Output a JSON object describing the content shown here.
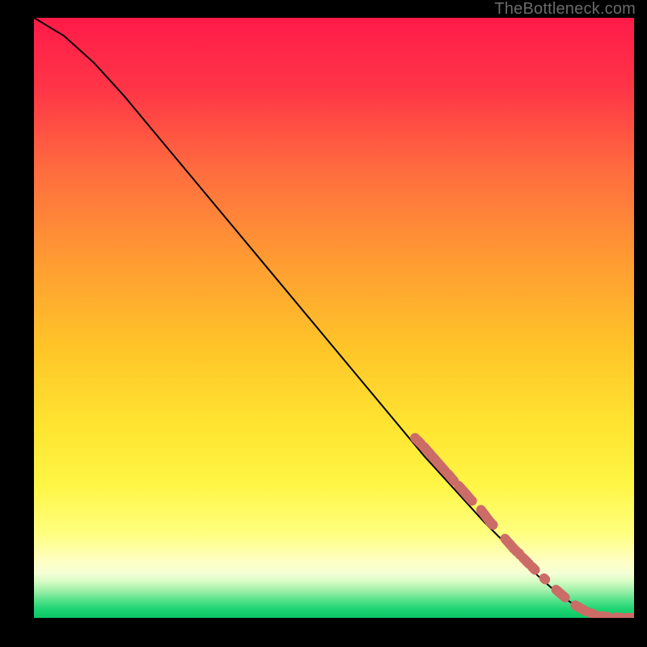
{
  "watermark": "TheBottleneck.com",
  "chart_data": {
    "type": "line",
    "title": "",
    "xlabel": "",
    "ylabel": "",
    "xlim": [
      0,
      100
    ],
    "ylim": [
      0,
      100
    ],
    "curve": {
      "name": "bottleneck-curve",
      "x": [
        0,
        5,
        10,
        15,
        20,
        25,
        30,
        35,
        40,
        45,
        50,
        55,
        60,
        65,
        70,
        75,
        80,
        82,
        84,
        86,
        88,
        90,
        92,
        94,
        96,
        98,
        100
      ],
      "y": [
        100,
        97,
        92.5,
        87,
        81,
        75,
        69,
        63,
        57,
        51,
        45,
        39,
        33,
        27,
        21.5,
        16,
        11,
        9,
        7,
        5.2,
        3.6,
        2.2,
        1.2,
        0.5,
        0.15,
        0.03,
        0
      ]
    },
    "markers": {
      "name": "segments",
      "color": "#cc6c67",
      "points": [
        [
          63.5,
          30.0
        ],
        [
          64.5,
          29.0
        ],
        [
          65.0,
          28.5
        ],
        [
          68.5,
          24.5
        ],
        [
          69.0,
          24.0
        ],
        [
          70.0,
          22.8
        ],
        [
          70.8,
          22.0
        ],
        [
          73.0,
          19.5
        ],
        [
          74.5,
          18.0
        ],
        [
          76.0,
          16.0
        ],
        [
          76.0,
          16.0
        ],
        [
          76.5,
          15.5
        ],
        [
          78.5,
          13.2
        ],
        [
          80.0,
          11.5
        ],
        [
          80.0,
          11.5
        ],
        [
          80.5,
          11.0
        ],
        [
          80.8,
          10.8
        ],
        [
          81.0,
          10.5
        ],
        [
          81.5,
          10.0
        ],
        [
          82.5,
          9.0
        ],
        [
          83.0,
          8.5
        ],
        [
          83.5,
          8.0
        ],
        [
          85.0,
          6.6
        ],
        [
          85.2,
          6.4
        ],
        [
          87.0,
          4.7
        ],
        [
          88.5,
          3.4
        ],
        [
          90.2,
          2.1
        ],
        [
          92.0,
          1.1
        ],
        [
          92.8,
          0.8
        ],
        [
          93.5,
          0.5
        ],
        [
          94.5,
          0.3
        ],
        [
          95.8,
          0.15
        ],
        [
          97.0,
          0.08
        ],
        [
          98.0,
          0.04
        ],
        [
          98.8,
          0.02
        ],
        [
          99.8,
          0.0
        ]
      ]
    },
    "gradient_stops": [
      {
        "offset": 0.0,
        "color": "#ff1a49"
      },
      {
        "offset": 0.12,
        "color": "#ff3647"
      },
      {
        "offset": 0.25,
        "color": "#ff6b3f"
      },
      {
        "offset": 0.4,
        "color": "#ff9a33"
      },
      {
        "offset": 0.55,
        "color": "#ffc528"
      },
      {
        "offset": 0.68,
        "color": "#ffe431"
      },
      {
        "offset": 0.78,
        "color": "#fff645"
      },
      {
        "offset": 0.86,
        "color": "#ffff80"
      },
      {
        "offset": 0.905,
        "color": "#ffffc3"
      },
      {
        "offset": 0.926,
        "color": "#f5ffd6"
      },
      {
        "offset": 0.94,
        "color": "#d4fbc3"
      },
      {
        "offset": 0.955,
        "color": "#9df0a8"
      },
      {
        "offset": 0.97,
        "color": "#57e38b"
      },
      {
        "offset": 0.985,
        "color": "#1fd473"
      },
      {
        "offset": 1.0,
        "color": "#0ac765"
      }
    ]
  }
}
